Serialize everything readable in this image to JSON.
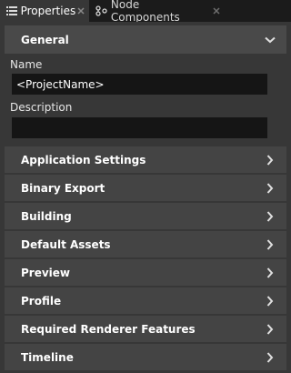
{
  "tabs": [
    {
      "label": "Properties",
      "icon": "list-icon",
      "active": true
    },
    {
      "label": "Node Components",
      "icon": "node-components-icon",
      "active": false
    }
  ],
  "general": {
    "title": "General",
    "name_label": "Name",
    "name_value": "<ProjectName>",
    "description_label": "Description",
    "description_value": ""
  },
  "categories": [
    {
      "label": "Application Settings"
    },
    {
      "label": "Binary Export"
    },
    {
      "label": "Building"
    },
    {
      "label": "Default Assets"
    },
    {
      "label": "Preview"
    },
    {
      "label": "Profile"
    },
    {
      "label": "Required Renderer Features"
    },
    {
      "label": "Timeline"
    }
  ],
  "colors": {
    "panel_bg": "#373737",
    "header_bg": "#494949",
    "row_bg": "#444444",
    "field_bg": "#151515",
    "tabbar_bg": "#1b1b1b"
  }
}
